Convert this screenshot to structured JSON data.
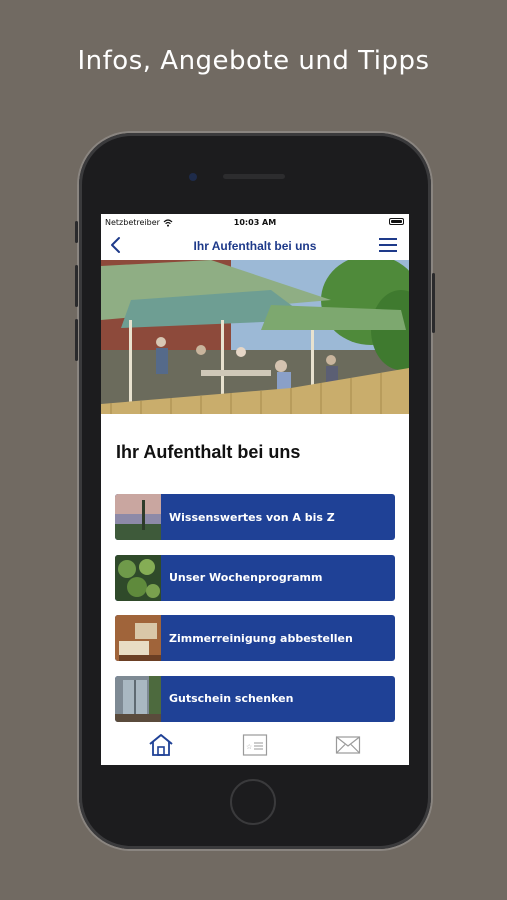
{
  "promo": {
    "title": "Infos, Angebote und Tipps"
  },
  "status_bar": {
    "carrier": "Netzbetreiber",
    "time": "10:03 AM"
  },
  "nav": {
    "back_icon": "chevron-left-icon",
    "title": "Ihr Aufenthalt bei uns",
    "menu_icon": "hamburger-menu-icon"
  },
  "colors": {
    "background": "#716a62",
    "accent": "#1f4196",
    "nav_text": "#1e3a8a"
  },
  "content": {
    "heading": "Ihr Aufenthalt bei uns",
    "items": [
      {
        "label": "Wissenswertes von A bis Z",
        "thumb": "sunset-lake-photo"
      },
      {
        "label": "Unser Wochenprogramm",
        "thumb": "water-lilies-photo"
      },
      {
        "label": "Zimmerreinigung abbestellen",
        "thumb": "hotel-room-photo"
      },
      {
        "label": "Gutschein schenken",
        "thumb": "hotel-window-photo"
      }
    ]
  },
  "tab_bar": {
    "tabs": [
      "home-icon",
      "coupon-card-icon",
      "mail-icon"
    ],
    "active": "home-icon"
  }
}
